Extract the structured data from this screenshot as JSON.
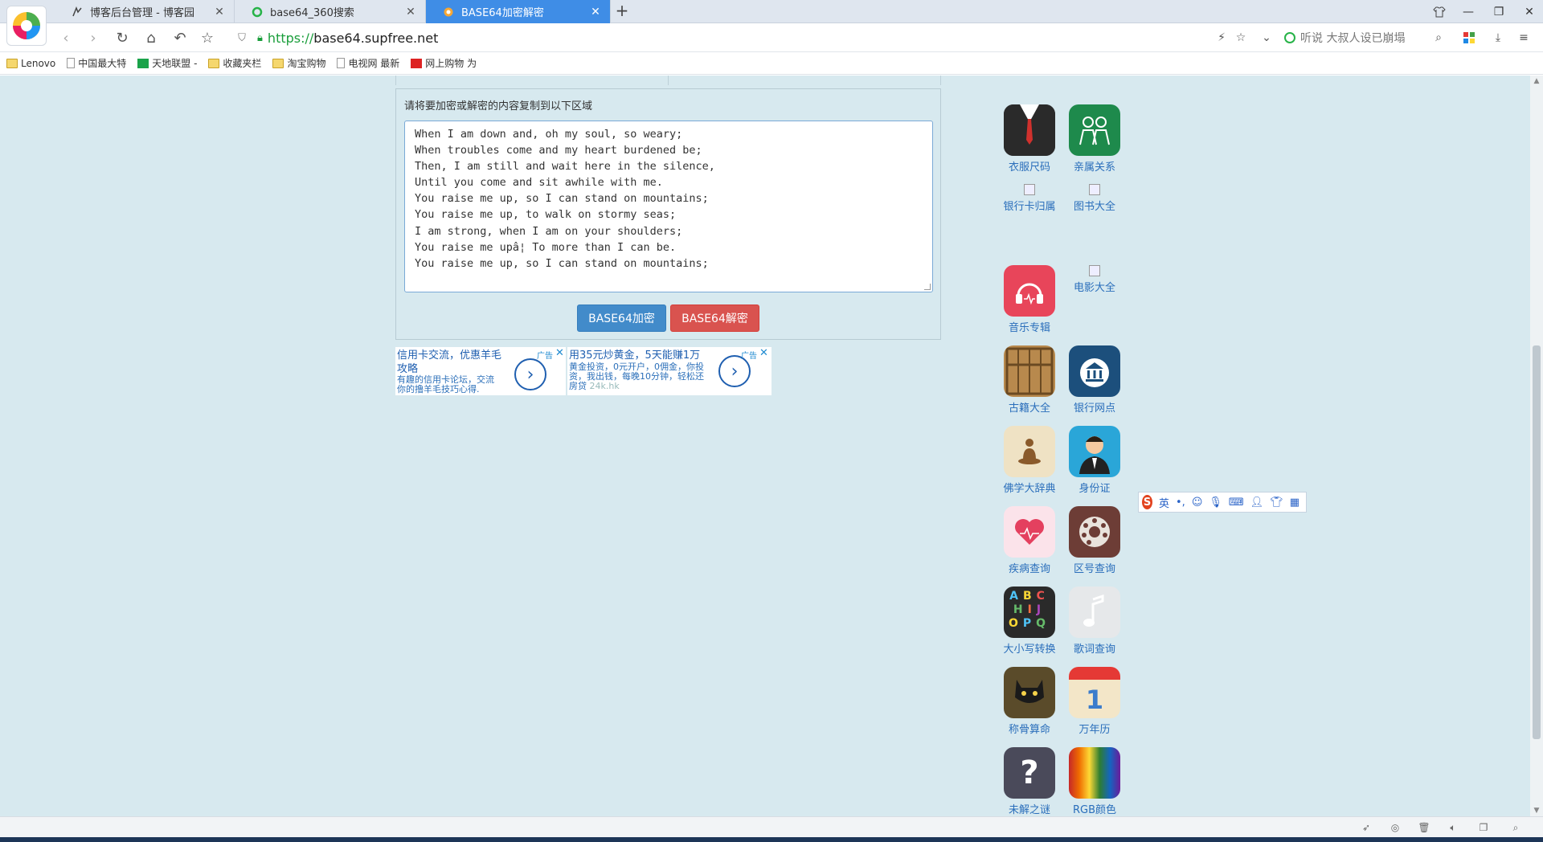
{
  "browser": {
    "tabs": [
      {
        "title": "博客后台管理 - 博客园",
        "icon": "cnblogs-icon",
        "active": false
      },
      {
        "title": "base64_360搜索",
        "icon": "so360-icon",
        "active": false
      },
      {
        "title": "BASE64加密解密",
        "icon": "site-icon",
        "active": true
      }
    ],
    "new_tab": "+",
    "url_scheme": "https://",
    "url_host": "base64.supfree.net",
    "search_placeholder": "听说 大叔人设已崩塌",
    "bookmarks": [
      {
        "label": "Lenovo",
        "icon": "folder-icon"
      },
      {
        "label": "中国最大特",
        "icon": "page-icon"
      },
      {
        "label": "天地联盟 -",
        "icon": "green-icon"
      },
      {
        "label": "收藏夹栏",
        "icon": "folder-icon"
      },
      {
        "label": "淘宝购物",
        "icon": "folder-icon"
      },
      {
        "label": "电视网 最新",
        "icon": "page-icon"
      },
      {
        "label": "网上购物 为",
        "icon": "red-icon"
      }
    ]
  },
  "main": {
    "prompt": "请将要加密或解密的内容复制到以下区域",
    "content_lines": [
      "When I am down and, oh my soul, so weary;",
      "When troubles come and my heart burdened be;",
      "Then, I am still and wait here in the silence,",
      "Until you come and sit awhile with me.",
      "You raise me up, so I can stand on mountains;",
      "You raise me up, to walk on stormy seas;",
      "I am strong, when I am on your shoulders;",
      "You raise me upâ¦ To more than I can be.",
      "You raise me up, so I can stand on mountains;"
    ],
    "encode_button": "BASE64加密",
    "decode_button": "BASE64解密"
  },
  "ads": [
    {
      "title_line1": "信用卡交流，优惠羊毛",
      "title_line2": "攻略",
      "desc_line1": "有趣的信用卡论坛，交流",
      "desc_line2": "你的撸羊毛技巧心得.",
      "tag": "广告",
      "close": "✕"
    },
    {
      "title_line1": "用35元炒黄金，5天能赚1万",
      "desc_line1": "黄金投资，0元开户，0佣金，你投",
      "desc_line2": "资，我出钱，每晚10分钟，轻松还",
      "desc_line3": "房贷",
      "source": "24k.hk",
      "tag": "广告",
      "close": "✕"
    }
  ],
  "apps": [
    {
      "label": "衣服尺码",
      "icon": "suit-icon",
      "color": "#2d2d2d"
    },
    {
      "label": "亲属关系",
      "icon": "family-icon",
      "color": "#1e8a4c"
    },
    {
      "label": "银行卡归属",
      "icon": "broken-image-icon"
    },
    {
      "label": "图书大全",
      "icon": "broken-image-icon"
    },
    {
      "label": "音乐专辑",
      "icon": "headphones-icon",
      "color": "#e8455a"
    },
    {
      "label": "电影大全",
      "icon": "broken-image-icon"
    },
    {
      "label": "古籍大全",
      "icon": "abacus-icon",
      "color": "#b8894d"
    },
    {
      "label": "银行网点",
      "icon": "bank-icon",
      "color": "#1c4f7c"
    },
    {
      "label": "佛学大辞典",
      "icon": "buddha-icon",
      "color": "#efe2c4"
    },
    {
      "label": "身份证",
      "icon": "person-icon",
      "color": "#2aa6d8"
    },
    {
      "label": "疾病查询",
      "icon": "heart-icon",
      "color": "#fbe3ea"
    },
    {
      "label": "区号查询",
      "icon": "rotary-phone-icon",
      "color": "#6d3d36"
    },
    {
      "label": "大小写转换",
      "icon": "letters-icon",
      "color": "#2a2a2a"
    },
    {
      "label": "歌词查询",
      "icon": "music-note-icon",
      "color": "#e6e8ea"
    },
    {
      "label": "称骨算命",
      "icon": "cat-icon",
      "color": "#5a4b2a"
    },
    {
      "label": "万年历",
      "icon": "calendar-icon",
      "color": "#f3e6c8"
    },
    {
      "label": "未解之谜",
      "icon": "question-icon",
      "color": "#4a4a5a"
    },
    {
      "label": "RGB颜色",
      "icon": "rainbow-icon",
      "color": "#c6332f"
    }
  ],
  "ime": {
    "lang": "英",
    "punct": "•,"
  },
  "colors": {
    "accent": "#3f8de6",
    "page_bg": "#d7e9ef",
    "link": "#2a6ebb",
    "encode": "#428bca",
    "decode": "#d9534f"
  }
}
